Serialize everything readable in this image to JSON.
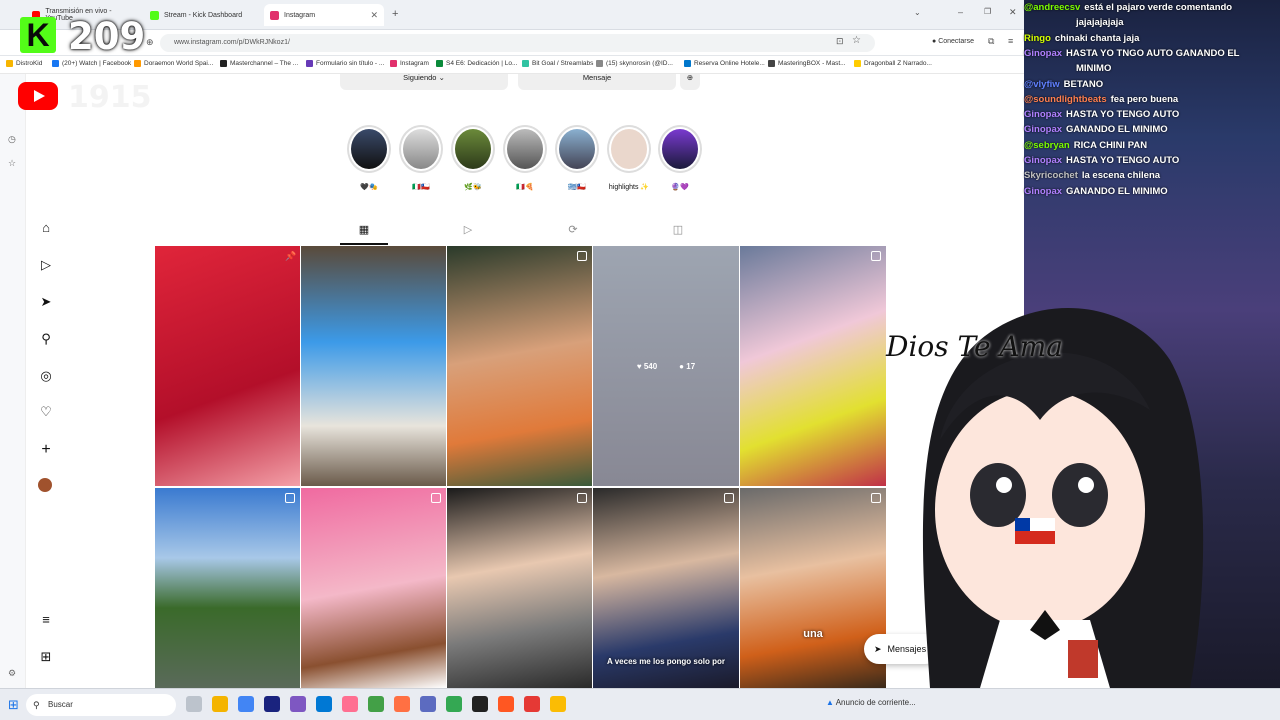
{
  "browser": {
    "tabs": [
      {
        "label": "Transmisión en vivo - YouTube",
        "color": "#ff0000"
      },
      {
        "label": "Stream - Kick Dashboard",
        "color": "#53fc18"
      },
      {
        "label": "Instagram",
        "color": "#e1306c"
      }
    ],
    "url": "www.instagram.com/p/DWkRJNkoz1/",
    "connect_label": "Conectarse",
    "bookmarks": [
      "DistroKid",
      "(20+) Watch | Facebook",
      "Doraemon World Spai...",
      "Masterchannel – The ...",
      "Formulario sin título - ...",
      "Instagram",
      "S4 E6: Dedicación | Lo...",
      "Bit Goal / Streamlabs",
      "(15) skynorosin (@ID...",
      "Reserva Online Hotele...",
      "MasteringBOX - Mast...",
      "Dragonball Z Narrado..."
    ]
  },
  "instagram": {
    "follow_label": "Siguiendo",
    "message_label": "Mensaje",
    "highlights": [
      {
        "label": "🖤🎭"
      },
      {
        "label": "🇮🇹🇨🇱"
      },
      {
        "label": "🌿🐝"
      },
      {
        "label": "🇮🇹🍕"
      },
      {
        "label": "🇬🇷🇨🇱"
      },
      {
        "label": "highlights ✨"
      },
      {
        "label": "🔮💜"
      }
    ],
    "hover_likes": "540",
    "hover_comments": "17",
    "grid_captions": [
      "A veces me los pongo solo por",
      "una"
    ],
    "messages_label": "Mensajes"
  },
  "taskbar": {
    "search_placeholder": "Buscar",
    "notice": "Anuncio de corriente..."
  },
  "stream": {
    "kick_viewers": "209",
    "youtube_viewers": "1915",
    "banner_text": "Dios Te Ama",
    "chat": [
      {
        "user": "@andreecsv",
        "msg": "está el pajaro verde comentando",
        "color": "#7cfc00"
      },
      {
        "user": "",
        "msg": "jajajajajaja",
        "color": "#ffffff"
      },
      {
        "user": "Ringo",
        "msg": "chinaki chanta jaja",
        "color": "#d4ff00"
      },
      {
        "user": "Ginopax",
        "msg": "HASTA YO TNGO AUTO GANANDO EL",
        "color": "#b080ff"
      },
      {
        "user": "",
        "msg": "MINIMO",
        "color": "#ffffff"
      },
      {
        "user": "@vlyfiw",
        "msg": "BETANO",
        "color": "#6080ff"
      },
      {
        "user": "@soundlightbeats",
        "msg": "fea pero buena",
        "color": "#ff7f50"
      },
      {
        "user": "Ginopax",
        "msg": "HASTA YO TENGO AUTO",
        "color": "#b080ff"
      },
      {
        "user": "Ginopax",
        "msg": "GANANDO EL MINIMO",
        "color": "#b080ff"
      },
      {
        "user": "@sebryan",
        "msg": "RICA CHINI PAN",
        "color": "#7cfc00"
      },
      {
        "user": "Ginopax",
        "msg": "HASTA YO TENGO AUTO",
        "color": "#b080ff"
      },
      {
        "user": "Skyricochet",
        "msg": "la escena chilena",
        "color": "#c0c0c0"
      },
      {
        "user": "Ginopax",
        "msg": "GANANDO EL MINIMO",
        "color": "#b080ff"
      }
    ]
  }
}
